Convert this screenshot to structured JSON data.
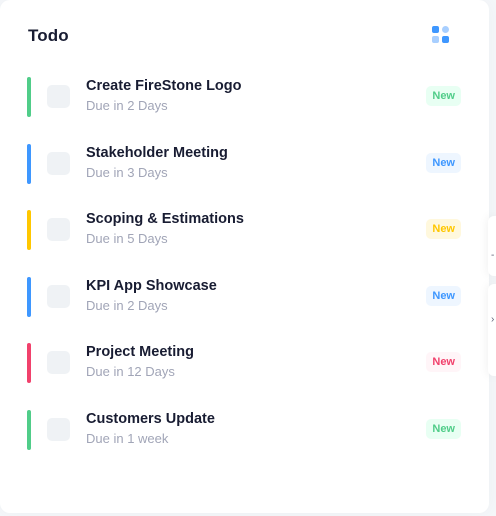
{
  "card": {
    "title": "Todo"
  },
  "icons": {
    "menu": "category-grid-icon",
    "menu_colors": [
      "#3e97ff",
      "#a8cfff"
    ]
  },
  "todos": [
    {
      "title": "Create FireStone Logo",
      "due": "Due in 2 Days",
      "badge": "New",
      "bullet_color": "#50cd89",
      "badge_bg": "#e8fff3",
      "badge_fg": "#50cd89"
    },
    {
      "title": "Stakeholder Meeting",
      "due": "Due in 3 Days",
      "badge": "New",
      "bullet_color": "#3e97ff",
      "badge_bg": "#eef6ff",
      "badge_fg": "#3e97ff"
    },
    {
      "title": "Scoping & Estimations",
      "due": "Due in 5 Days",
      "badge": "New",
      "bullet_color": "#ffc700",
      "badge_bg": "#fff8dd",
      "badge_fg": "#ffc700"
    },
    {
      "title": "KPI App Showcase",
      "due": "Due in 2 Days",
      "badge": "New",
      "bullet_color": "#3e97ff",
      "badge_bg": "#eef6ff",
      "badge_fg": "#3e97ff"
    },
    {
      "title": "Project Meeting",
      "due": "Due in 12 Days",
      "badge": "New",
      "bullet_color": "#f1416c",
      "badge_bg": "#fff5f8",
      "badge_fg": "#f1416c"
    },
    {
      "title": "Customers Update",
      "due": "Due in 1 week",
      "badge": "New",
      "bullet_color": "#50cd89",
      "badge_bg": "#e8fff3",
      "badge_fg": "#50cd89"
    }
  ]
}
